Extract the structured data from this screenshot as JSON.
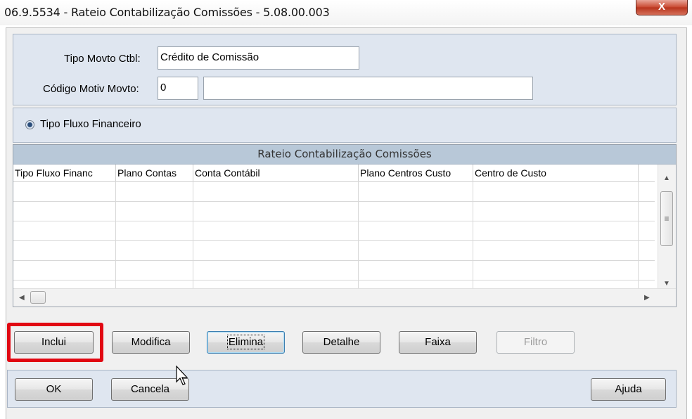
{
  "window": {
    "title": "06.9.5534 - Rateio Contabilização Comissões - 5.08.00.003",
    "close_glyph": "X"
  },
  "form": {
    "tipo_movto_label": "Tipo Movto Ctbl:",
    "tipo_movto_value": "Crédito de Comissão",
    "codigo_motiv_label": "Código Motiv Movto:",
    "codigo_motiv_value": "0",
    "codigo_motiv_desc": ""
  },
  "radio": {
    "label": "Tipo Fluxo Financeiro",
    "selected": true
  },
  "grid": {
    "title": "Rateio Contabilização Comissões",
    "columns": [
      "Tipo Fluxo Financ",
      "Plano Contas",
      "Conta Contábil",
      "Plano Centros Custo",
      "Centro de Custo"
    ],
    "rows": []
  },
  "actions": {
    "inclui": "Inclui",
    "modifica": "Modifica",
    "elimina": "Elimina",
    "detalhe": "Detalhe",
    "faixa": "Faixa",
    "filtro": "Filtro"
  },
  "footer": {
    "ok": "OK",
    "cancela": "Cancela",
    "ajuda": "Ajuda"
  },
  "colors": {
    "highlight": "#e10712",
    "group_bg": "#dfe6f0",
    "grid_title_bg": "#b8c8d8"
  }
}
